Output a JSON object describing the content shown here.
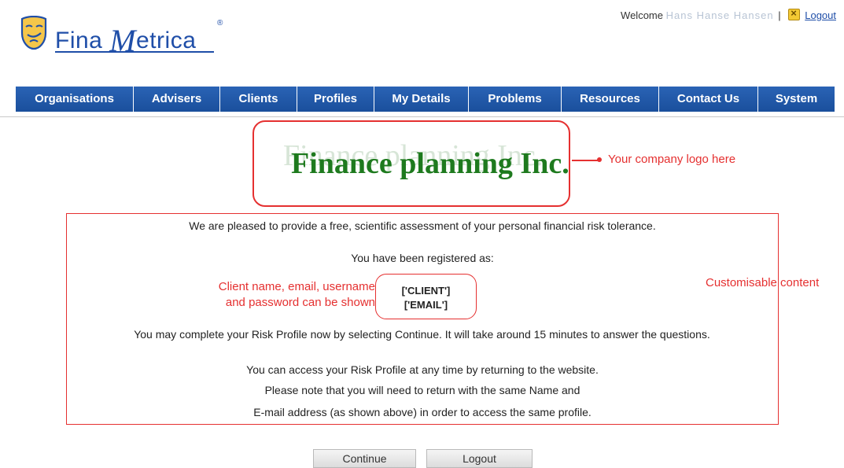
{
  "header": {
    "brand": {
      "part1": "Fina",
      "part2": "M",
      "part3": "etrica",
      "registered": "®"
    },
    "welcome_label": "Welcome",
    "username": "Hans Hanse Hansen",
    "separator": "|",
    "logout_link": "Logout"
  },
  "nav": {
    "tabs": [
      {
        "label": "Organisations"
      },
      {
        "label": "Advisers"
      },
      {
        "label": "Clients"
      },
      {
        "label": "Profiles"
      },
      {
        "label": "My Details"
      },
      {
        "label": "Problems"
      },
      {
        "label": "Resources"
      },
      {
        "label": "Contact Us"
      },
      {
        "label": "System"
      }
    ]
  },
  "company": {
    "name": "Finance planning Inc.",
    "logo_annotation": "Your company logo here"
  },
  "content": {
    "line1": "We are pleased to provide a free, scientific assessment of your personal financial risk tolerance.",
    "line2": "You have been registered as:",
    "client_token": "['CLIENT']",
    "email_token": "['EMAIL']",
    "client_annotation_line1": "Client name, email, username",
    "client_annotation_line2": "and password can be shown",
    "custom_annotation": "Customisable content",
    "line3": "You may complete your Risk Profile now by selecting Continue. It will take around 15 minutes to answer the questions.",
    "line4": "You can access your Risk Profile at any time by returning to the website.",
    "line5": "Please note that you will need to return with the same Name and",
    "line6": "E-mail address (as shown above) in order to access the same profile."
  },
  "buttons": {
    "continue_label": "Continue",
    "logout_label": "Logout"
  },
  "colors": {
    "nav_blue": "#1f57a6",
    "brand_blue": "#1f4ea8",
    "annotation_red": "#e53030",
    "company_green": "#1e7a1e"
  }
}
